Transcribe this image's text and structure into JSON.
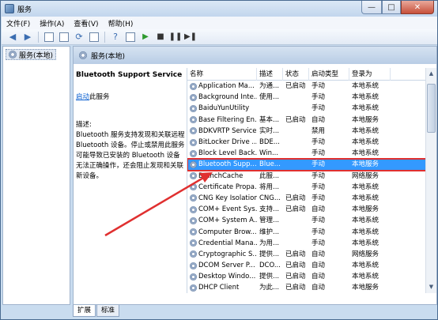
{
  "window": {
    "title": "服务",
    "icon": "services-app-icon"
  },
  "menu": [
    "文件(F)",
    "操作(A)",
    "查看(V)",
    "帮助(H)"
  ],
  "tree": {
    "root_label": "服务(本地)"
  },
  "right_header": "服务(本地)",
  "description": {
    "service_name": "Bluetooth Support Service",
    "action_link": "启动",
    "action_suffix": "此服务",
    "label": "描述:",
    "text": "Bluetooth 服务支持发现和关联远程 Bluetooth 设备。停止或禁用此服务可能导致已安装的 Bluetooth 设备无法正确操作，还会阻止发现和关联新设备。"
  },
  "table": {
    "columns": [
      "名称",
      "描述",
      "状态",
      "启动类型",
      "登录为"
    ],
    "rows": [
      {
        "name": "Application Ma...",
        "desc": "为通...",
        "status": "已启动",
        "startup": "手动",
        "logon": "本地系统"
      },
      {
        "name": "Background Inte...",
        "desc": "使用...",
        "status": "",
        "startup": "手动",
        "logon": "本地系统"
      },
      {
        "name": "BaiduYunUtility",
        "desc": "",
        "status": "",
        "startup": "手动",
        "logon": "本地系统"
      },
      {
        "name": "Base Filtering En...",
        "desc": "基本...",
        "status": "已启动",
        "startup": "自动",
        "logon": "本地服务"
      },
      {
        "name": "BDKVRTP Service",
        "desc": "实时...",
        "status": "",
        "startup": "禁用",
        "logon": "本地系统"
      },
      {
        "name": "BitLocker Drive ...",
        "desc": "BDE...",
        "status": "",
        "startup": "手动",
        "logon": "本地系统"
      },
      {
        "name": "Block Level Back...",
        "desc": "Win...",
        "status": "",
        "startup": "手动",
        "logon": "本地系统"
      },
      {
        "name": "Bluetooth Supp...",
        "desc": "Blue...",
        "status": "",
        "startup": "手动",
        "logon": "本地服务"
      },
      {
        "name": "BranchCache",
        "desc": "此服...",
        "status": "",
        "startup": "手动",
        "logon": "网络服务"
      },
      {
        "name": "Certificate Propa...",
        "desc": "将用...",
        "status": "",
        "startup": "手动",
        "logon": "本地系统"
      },
      {
        "name": "CNG Key Isolation",
        "desc": "CNG...",
        "status": "已启动",
        "startup": "手动",
        "logon": "本地系统"
      },
      {
        "name": "COM+ Event Sys...",
        "desc": "支持...",
        "status": "已启动",
        "startup": "自动",
        "logon": "本地服务"
      },
      {
        "name": "COM+ System A...",
        "desc": "管理...",
        "status": "",
        "startup": "手动",
        "logon": "本地系统"
      },
      {
        "name": "Computer Brow...",
        "desc": "维护...",
        "status": "",
        "startup": "手动",
        "logon": "本地系统"
      },
      {
        "name": "Credential Mana...",
        "desc": "为用...",
        "status": "",
        "startup": "手动",
        "logon": "本地系统"
      },
      {
        "name": "Cryptographic S...",
        "desc": "提供...",
        "status": "已启动",
        "startup": "自动",
        "logon": "网络服务"
      },
      {
        "name": "DCOM Server P...",
        "desc": "DCO...",
        "status": "已启动",
        "startup": "自动",
        "logon": "本地系统"
      },
      {
        "name": "Desktop Windo...",
        "desc": "提供...",
        "status": "已启动",
        "startup": "自动",
        "logon": "本地系统"
      },
      {
        "name": "DHCP Client",
        "desc": "为此...",
        "status": "已启动",
        "startup": "自动",
        "logon": "本地服务"
      }
    ],
    "selected_index": 7
  },
  "tabs": [
    "扩展",
    "标准"
  ],
  "colors": {
    "selection": "#3399ff",
    "highlight_border": "#e03030",
    "annotation_arrow": "#e03030"
  }
}
